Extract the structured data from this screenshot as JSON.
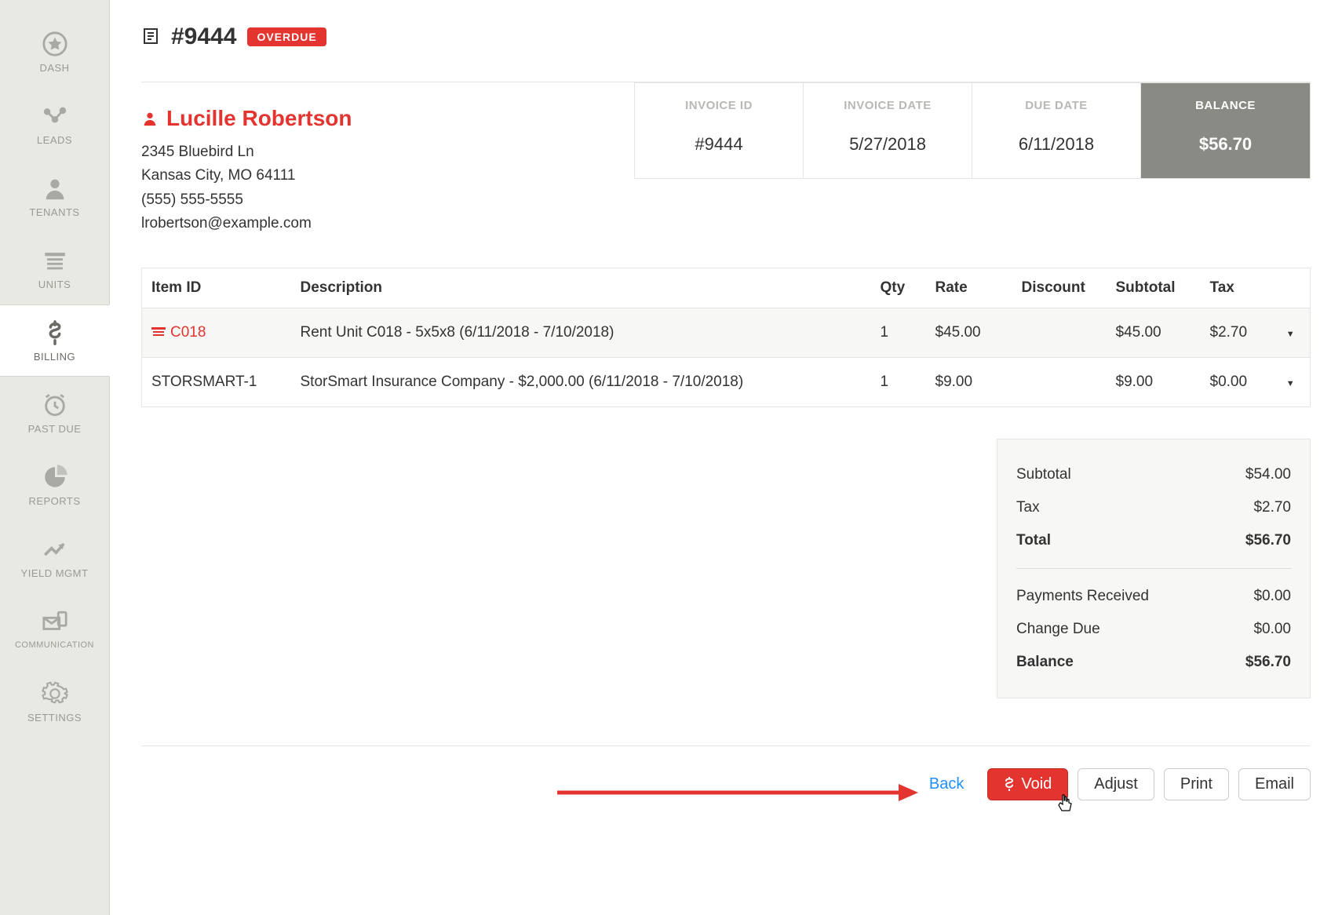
{
  "sidebar": {
    "items": [
      {
        "label": "DASH"
      },
      {
        "label": "LEADS"
      },
      {
        "label": "TENANTS"
      },
      {
        "label": "UNITS"
      },
      {
        "label": "BILLING"
      },
      {
        "label": "PAST DUE"
      },
      {
        "label": "REPORTS"
      },
      {
        "label": "YIELD MGMT"
      },
      {
        "label": "COMMUNICATION"
      },
      {
        "label": "SETTINGS"
      }
    ]
  },
  "header": {
    "invoice_number": "#9444",
    "status_badge": "OVERDUE"
  },
  "customer": {
    "name": "Lucille Robertson",
    "address_line1": "2345 Bluebird Ln",
    "address_line2": "Kansas City, MO 64111",
    "phone": "(555) 555-5555",
    "email": "lrobertson@example.com"
  },
  "summary": {
    "labels": {
      "invoice_id": "INVOICE ID",
      "invoice_date": "INVOICE DATE",
      "due_date": "DUE DATE",
      "balance": "BALANCE"
    },
    "invoice_id": "#9444",
    "invoice_date": "5/27/2018",
    "due_date": "6/11/2018",
    "balance": "$56.70"
  },
  "table": {
    "headers": {
      "item_id": "Item ID",
      "description": "Description",
      "qty": "Qty",
      "rate": "Rate",
      "discount": "Discount",
      "subtotal": "Subtotal",
      "tax": "Tax"
    },
    "rows": [
      {
        "item_id": "C018",
        "description": "Rent Unit C018 - 5x5x8 (6/11/2018 - 7/10/2018)",
        "qty": "1",
        "rate": "$45.00",
        "discount": "",
        "subtotal": "$45.00",
        "tax": "$2.70"
      },
      {
        "item_id": "STORSMART-1",
        "description": "StorSmart Insurance Company - $2,000.00 (6/11/2018 - 7/10/2018)",
        "qty": "1",
        "rate": "$9.00",
        "discount": "",
        "subtotal": "$9.00",
        "tax": "$0.00"
      }
    ]
  },
  "totals": {
    "subtotal_label": "Subtotal",
    "subtotal": "$54.00",
    "tax_label": "Tax",
    "tax": "$2.70",
    "total_label": "Total",
    "total": "$56.70",
    "payments_label": "Payments Received",
    "payments": "$0.00",
    "change_label": "Change Due",
    "change": "$0.00",
    "balance_label": "Balance",
    "balance": "$56.70"
  },
  "actions": {
    "back": "Back",
    "void": "Void",
    "adjust": "Adjust",
    "print": "Print",
    "email": "Email"
  }
}
